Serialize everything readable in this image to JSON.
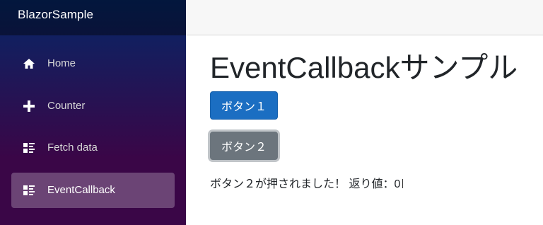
{
  "sidebar": {
    "brand": "BlazorSample",
    "items": [
      {
        "label": "Home",
        "icon": "home-icon",
        "active": false
      },
      {
        "label": "Counter",
        "icon": "plus-icon",
        "active": false
      },
      {
        "label": "Fetch data",
        "icon": "list-icon",
        "active": false
      },
      {
        "label": "EventCallback",
        "icon": "list-icon",
        "active": true
      }
    ]
  },
  "main": {
    "title": "EventCallbackサンプル",
    "button1_label": "ボタン１",
    "button2_label": "ボタン２",
    "message": "ボタン２が押されました！ 返り値：0"
  },
  "colors": {
    "sidebar_top": "#052767",
    "sidebar_bottom": "#3a0647",
    "primary": "#1b6ec2",
    "secondary": "#6c757d"
  }
}
